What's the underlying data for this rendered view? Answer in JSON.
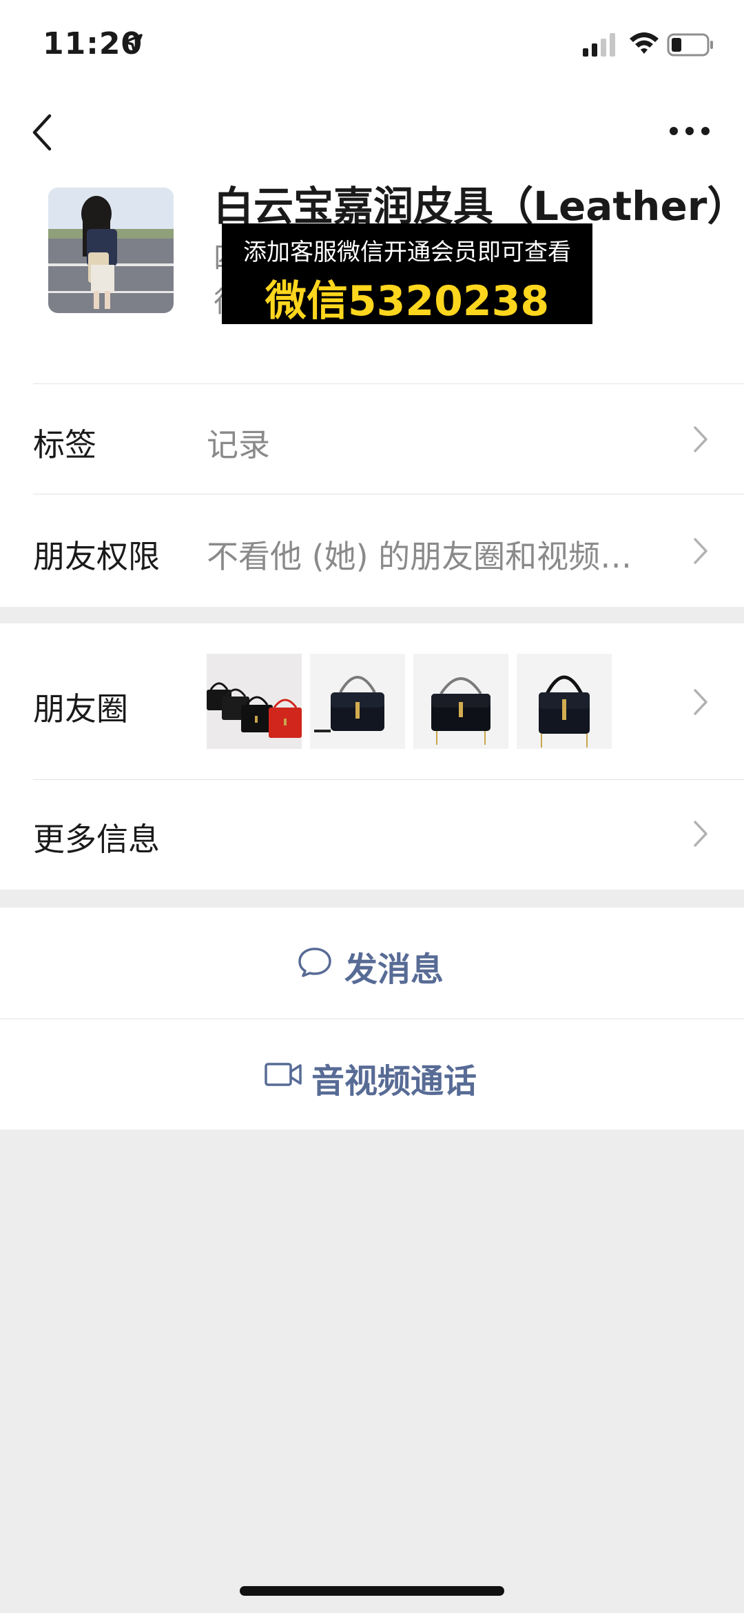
{
  "status_bar": {
    "time": "11:20"
  },
  "profile": {
    "name": "白云宝嘉润皮具（Leather）",
    "subtitle_line1_prefix": "四",
    "subtitle_line2_prefix": "徂"
  },
  "overlay": {
    "line1": "添加客服微信开通会员即可查看",
    "line2": "微信5320238"
  },
  "rows": {
    "tags": {
      "label": "标签",
      "value": "记录"
    },
    "permissions": {
      "label": "朋友权限",
      "value": "不看他 (她) 的朋友圈和视频…"
    },
    "moments": {
      "label": "朋友圈"
    },
    "more_info": {
      "label": "更多信息"
    }
  },
  "actions": {
    "send_message": "发消息",
    "video_call": "音视频通话"
  },
  "colors": {
    "accent": "#576b95",
    "background": "#ededed",
    "overlay_highlight": "#ffd61e"
  },
  "icons": {
    "location": "location-arrow-icon",
    "signal": "cellular-signal-icon",
    "wifi": "wifi-icon",
    "battery": "battery-icon",
    "back": "back-chevron-icon",
    "more": "more-dots-icon",
    "message": "chat-bubble-icon",
    "video": "video-camera-icon"
  }
}
